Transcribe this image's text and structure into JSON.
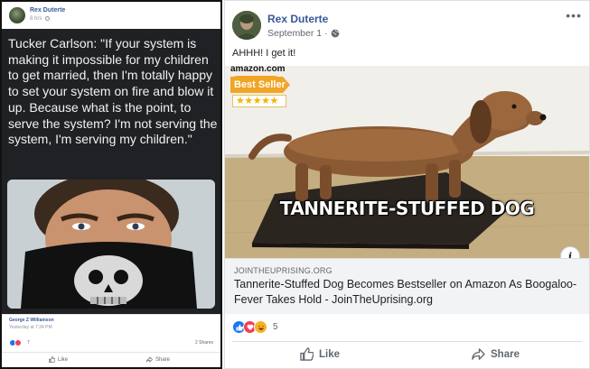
{
  "left_post": {
    "author": "Rex Duterte",
    "time": "8 hrs",
    "quote": "Tucker Carlson: \"If your system is making it impossible for my children to get married, then I'm totally happy to set your system on fire and blow it up. Because what is the point, to serve the system? I'm not serving the system, I'm serving my children.\"",
    "shared_from_name": "George Z Williamson",
    "shared_from_time": "Yesterday at 7:34 PM",
    "reaction_count": "7",
    "shares": "2 Shares",
    "like_label": "Like",
    "share_label": "Share"
  },
  "right_post": {
    "author": "Rex Duterte",
    "date": "September 1",
    "separator": "·",
    "more": "•••",
    "text": "AHHH! I get it!",
    "image": {
      "amazon_label": "amazon.com",
      "badge": "Best Seller",
      "stars": "★★★★★",
      "caption": "TANNERITE-STUFFED DOG"
    },
    "info_label": "i",
    "link_domain": "JOINTHEUPRISING.ORG",
    "link_title": "Tannerite-Stuffed Dog Becomes Bestseller on Amazon As Boogaloo-Fever Takes Hold - JoinTheUprising.org",
    "reaction_count": "5",
    "like_label": "Like",
    "share_label": "Share"
  },
  "colors": {
    "facebook_blue": "#385898",
    "like_blue": "#1877f2",
    "love_red": "#f33e58",
    "haha_yellow": "#f7b125",
    "bestseller_orange": "#f0a526",
    "dark_quote_bg": "#1f2124"
  }
}
